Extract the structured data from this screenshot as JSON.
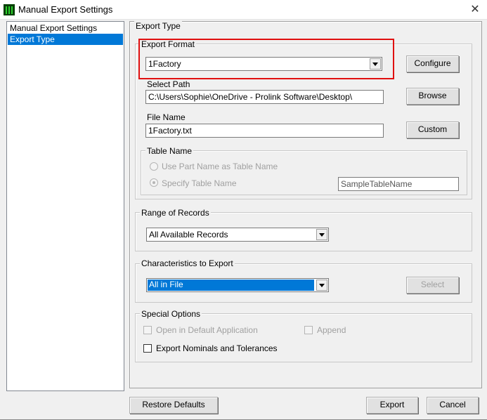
{
  "window": {
    "title": "Manual Export Settings",
    "close_glyph": "✕"
  },
  "sidebar": {
    "items": [
      {
        "label": "Manual Export Settings",
        "selected": false
      },
      {
        "label": "Export Type",
        "selected": true
      }
    ]
  },
  "export_type": {
    "group_label": "Export Type",
    "format": {
      "label": "Export Format",
      "value": "1Factory",
      "configure_label": "Configure"
    },
    "path": {
      "label": "Select Path",
      "value": "C:\\Users\\Sophie\\OneDrive - Prolink Software\\Desktop\\",
      "browse_label": "Browse"
    },
    "file": {
      "label": "File Name",
      "value": "1Factory.txt",
      "custom_label": "Custom"
    },
    "table_name": {
      "label": "Table Name",
      "option_part": "Use Part Name as Table Name",
      "option_specify": "Specify Table Name",
      "selected": "specify",
      "value": "SampleTableName"
    }
  },
  "range": {
    "label": "Range of Records",
    "value": "All Available Records"
  },
  "characteristics": {
    "label": "Characteristics to Export",
    "value": "All in File",
    "select_label": "Select"
  },
  "special": {
    "label": "Special Options",
    "open_default": {
      "label": "Open in Default Application",
      "checked": false
    },
    "append": {
      "label": "Append",
      "checked": false
    },
    "nominals": {
      "label": "Export Nominals and Tolerances",
      "checked": false
    }
  },
  "footer": {
    "restore_label": "Restore Defaults",
    "export_label": "Export",
    "cancel_label": "Cancel"
  },
  "colors": {
    "selection": "#0078d7",
    "highlight_box": "#e01010"
  }
}
